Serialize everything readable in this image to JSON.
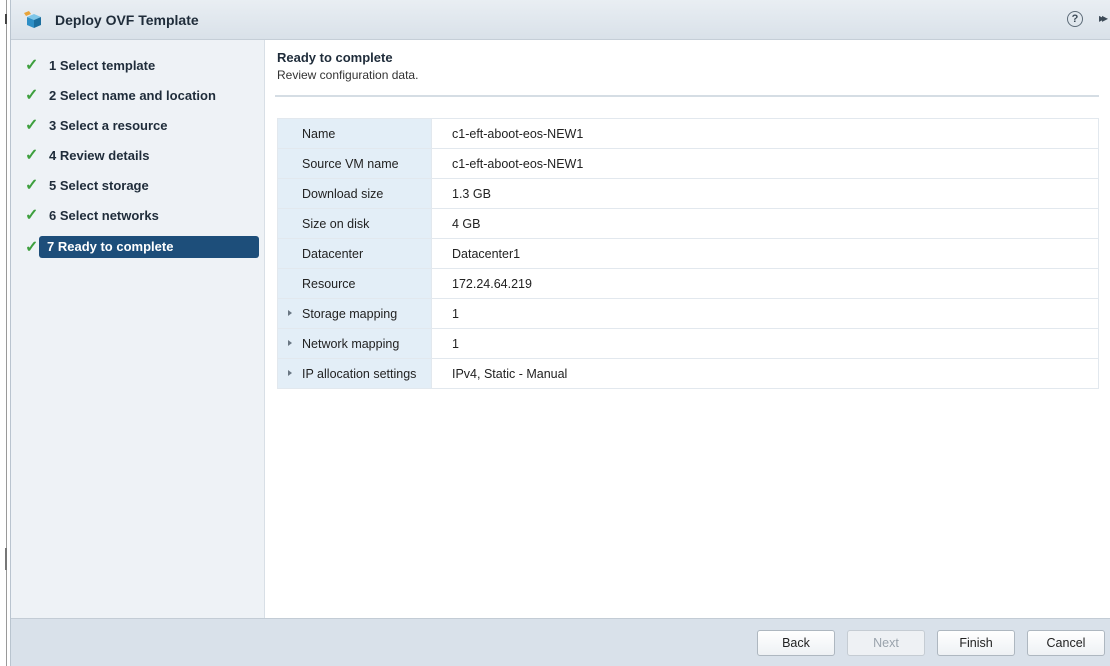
{
  "window": {
    "title": "Deploy OVF Template"
  },
  "icons": {
    "app": "ovf-package-icon",
    "help": "help-icon",
    "expand": "double-chevron-right-icon",
    "check": "checkmark-icon",
    "expander": "triangle-right-icon"
  },
  "colors": {
    "accent": "#1d4e7a",
    "check": "#3e9f3e",
    "key_bg": "#e3eef7",
    "footer_bg": "#d9e1ea"
  },
  "steps": [
    {
      "label": "1  Select template",
      "done": true
    },
    {
      "label": "2  Select name and location",
      "done": true
    },
    {
      "label": "3  Select a resource",
      "done": true
    },
    {
      "label": "4  Review details",
      "done": true
    },
    {
      "label": "5  Select storage",
      "done": true
    },
    {
      "label": "6  Select networks",
      "done": true
    },
    {
      "label": "7  Ready to complete",
      "done": true,
      "active": true
    }
  ],
  "main": {
    "title": "Ready to complete",
    "subtitle": "Review configuration data.",
    "rows": [
      {
        "key": "Name",
        "value": "c1-eft-aboot-eos-NEW1",
        "expandable": false
      },
      {
        "key": "Source VM name",
        "value": "c1-eft-aboot-eos-NEW1",
        "expandable": false
      },
      {
        "key": "Download size",
        "value": "1.3 GB",
        "expandable": false
      },
      {
        "key": "Size on disk",
        "value": "4 GB",
        "expandable": false
      },
      {
        "key": "Datacenter",
        "value": "Datacenter1",
        "expandable": false
      },
      {
        "key": "Resource",
        "value": "172.24.64.219",
        "expandable": false
      },
      {
        "key": "Storage mapping",
        "value": "1",
        "expandable": true
      },
      {
        "key": "Network mapping",
        "value": "1",
        "expandable": true
      },
      {
        "key": "IP allocation settings",
        "value": "IPv4, Static - Manual",
        "expandable": true
      }
    ]
  },
  "footer": {
    "back": "Back",
    "next": "Next",
    "finish": "Finish",
    "cancel": "Cancel"
  }
}
